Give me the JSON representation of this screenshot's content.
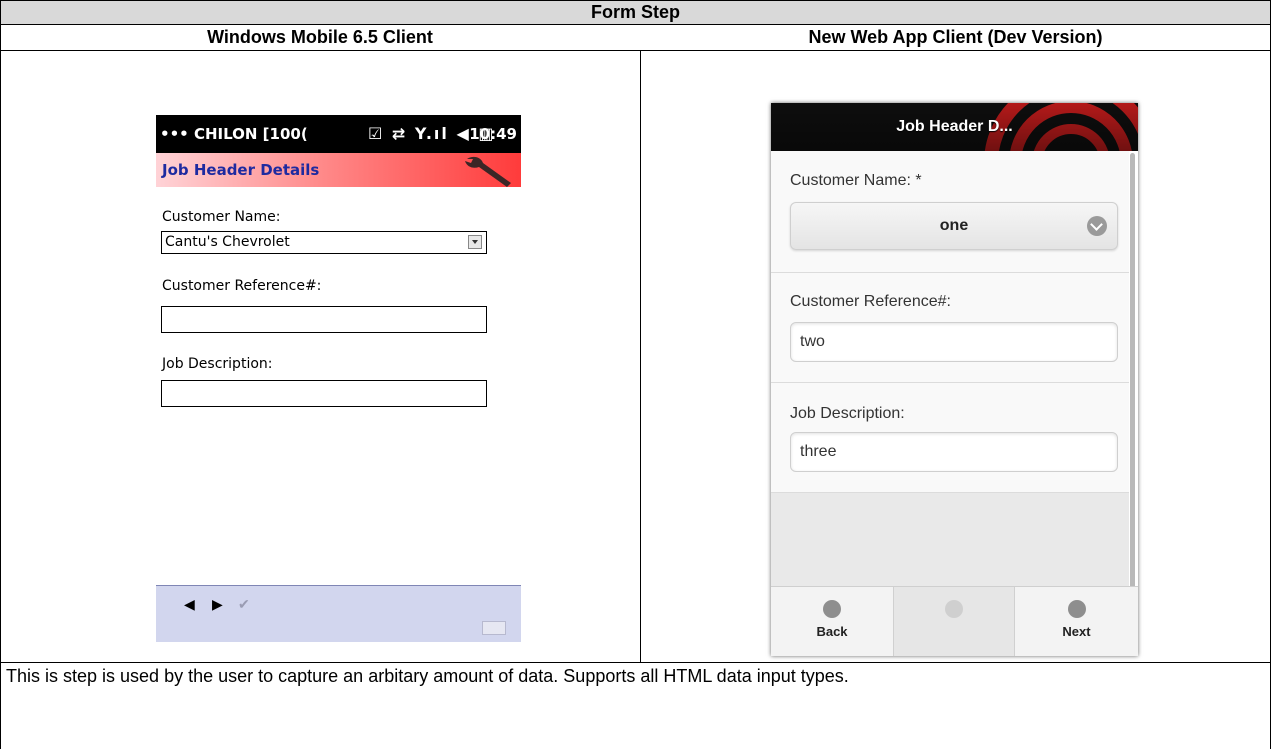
{
  "document": {
    "table_title": "Form Step",
    "left_header": "Windows Mobile 6.5 Client",
    "right_header": "New Web App Client (Dev Version)",
    "description": "This is step is used by the user to capture an arbitary amount of data. Supports all HTML data input types."
  },
  "wm_client": {
    "carrier": "••• CHILON [100(",
    "status_icons": "☑ ⇄ Y.ıl ◀ ▥",
    "time": "10:49",
    "title": "Job Header Details",
    "fields": {
      "customer_name_label": "Customer Name:",
      "customer_name_value": "Cantu's Chevrolet",
      "reference_label": "Customer Reference#:",
      "description_label": "Job Description:"
    },
    "nav": {
      "back": "◀",
      "forward": "▶",
      "check": "✔"
    }
  },
  "web_client": {
    "title": "Job Header D...",
    "customer_name_label": "Customer Name: *",
    "customer_name_value": "one",
    "reference_label": "Customer Reference#:",
    "reference_value": "two",
    "description_label": "Job Description:",
    "description_value": "three",
    "footer": {
      "back": "Back",
      "next": "Next"
    }
  },
  "colors": {
    "table_header_bg": "#d9d9d9",
    "wm_title_text": "#1e2aa0",
    "wm_bottom_bar": "#d2d6ee",
    "web_header_accent": "#e02020"
  }
}
